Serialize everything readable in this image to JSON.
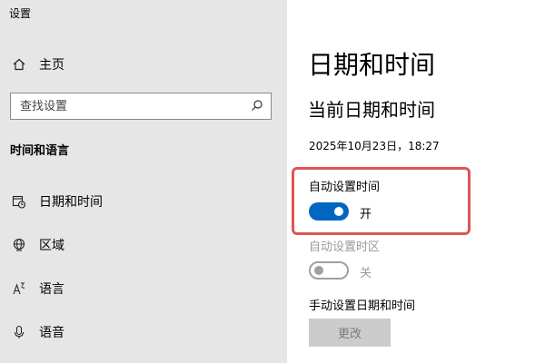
{
  "window": {
    "title": "设置"
  },
  "sidebar": {
    "home_label": "主页",
    "search": {
      "placeholder": "查找设置"
    },
    "section_title": "时间和语言",
    "items": [
      {
        "label": "日期和时间",
        "icon": "calendar-clock-icon"
      },
      {
        "label": "区域",
        "icon": "globe-icon"
      },
      {
        "label": "语言",
        "icon": "language-icon"
      },
      {
        "label": "语音",
        "icon": "microphone-icon"
      }
    ]
  },
  "main": {
    "title": "日期和时间",
    "subtitle": "当前日期和时间",
    "current_datetime": "2025年10月23日，18:27",
    "auto_time": {
      "label": "自动设置时间",
      "state": "开",
      "on": true
    },
    "auto_timezone": {
      "label": "自动设置时区",
      "state": "关",
      "on": false
    },
    "manual": {
      "label": "手动设置日期和时间",
      "button_label": "更改"
    }
  },
  "colors": {
    "accent": "#0067c0",
    "highlight": "#e05555",
    "sidebar_bg": "#e6e6e6"
  }
}
